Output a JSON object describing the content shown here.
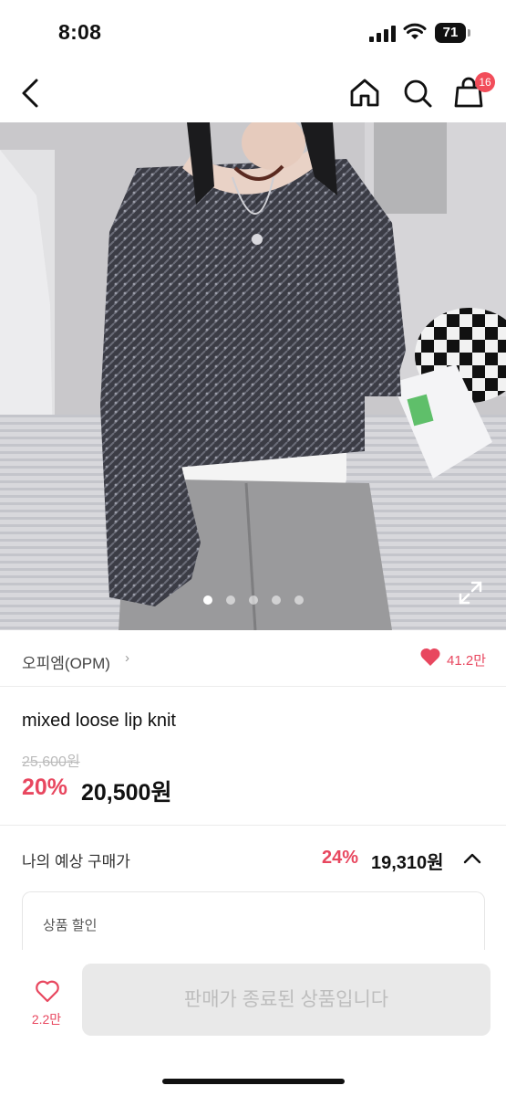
{
  "status_bar": {
    "time": "8:08",
    "battery_level": "71",
    "icons": [
      "signal-icon",
      "wifi-icon",
      "battery-icon"
    ]
  },
  "nav": {
    "icons": [
      "back-arrow-icon",
      "home-icon",
      "search-icon",
      "cart-icon"
    ],
    "cart_badge_count": "16"
  },
  "gallery": {
    "image_count": 5,
    "active_index": 0,
    "expand_icon": "expand-icon"
  },
  "brand": {
    "name": "오피엠(OPM)",
    "chevron": "›",
    "like_count": "41.2만"
  },
  "product": {
    "title": "mixed loose lip knit",
    "original_price": "25,600원",
    "discount_rate": "20%",
    "sale_price": "20,500원"
  },
  "expected_price": {
    "label": "나의 예상 구매가",
    "rate": "24%",
    "price": "19,310원"
  },
  "discount_box": {
    "label": "상품 할인"
  },
  "bottom_bar": {
    "wish_count": "2.2만",
    "buy_button_label": "판매가 종료된 상품입니다"
  },
  "colors": {
    "accent": "#e8475f",
    "badge": "#f24d5a",
    "disabled_button": "#e9e9e9",
    "disabled_text": "#bdbdbd"
  }
}
